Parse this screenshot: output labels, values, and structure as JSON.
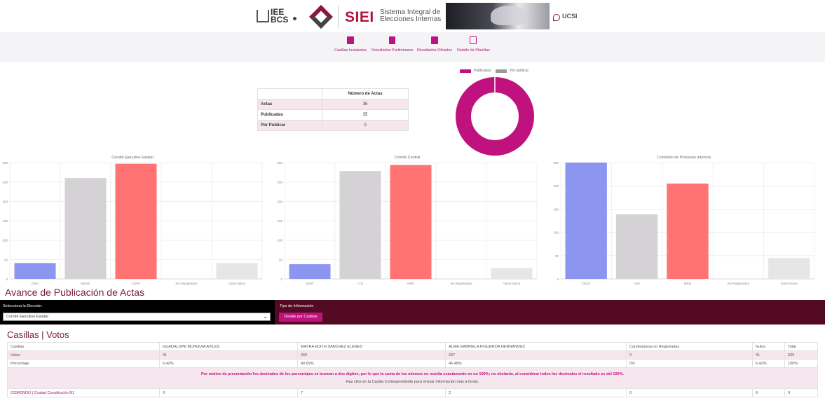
{
  "header": {
    "logo_text": "IEE BCS",
    "brand": "SIEI",
    "brand_subtitle": "Sistema Integral de Elecciones Internas",
    "org": "UCSI"
  },
  "nav": {
    "items": [
      {
        "label": "Casillas Instaladas",
        "icon": "boxes-icon"
      },
      {
        "label": "Resultados Preliminares",
        "icon": "document-icon"
      },
      {
        "label": "Resultados Oficiales",
        "icon": "ballot-icon"
      },
      {
        "label": "Detalle de Planillas",
        "icon": "table-icon"
      }
    ]
  },
  "summary": {
    "header": "Número de Actas",
    "rows": [
      {
        "label": "Actas",
        "value": "35"
      },
      {
        "label": "Publicadas",
        "value": "35"
      },
      {
        "label": "Por Publicar",
        "value": "0"
      }
    ]
  },
  "colors": {
    "accent": "#c0127e",
    "dark": "#540a22",
    "title": "#7a1740",
    "blue": "#8c96f0",
    "gray": "#d5d2d6",
    "red": "#ff7373",
    "light": "#e6e6e6"
  },
  "chart_data": [
    {
      "type": "pie",
      "variant": "doughnut",
      "legend": [
        "Publicadas",
        "Por publicar"
      ],
      "values": [
        35,
        0
      ],
      "colors": [
        "#c0127e",
        "#9b9b9b"
      ]
    },
    {
      "type": "bar",
      "title": "Comité Ejecutivo Estatal",
      "categories": [
        "GMA",
        "MESE",
        "AGFH",
        "No Registrados",
        "Votos Nulos"
      ],
      "values": [
        41,
        260,
        297,
        0,
        41
      ],
      "ylim": [
        0,
        300
      ],
      "yticks": [
        0,
        50,
        100,
        150,
        200,
        250,
        300
      ],
      "grid": true
    },
    {
      "type": "bar",
      "title": "Comité Central",
      "categories": [
        "MGR",
        "LTG",
        "AIRG",
        "No Registrados",
        "Votos Nulos"
      ],
      "values": [
        38,
        278,
        294,
        0,
        28
      ],
      "ylim": [
        0,
        300
      ],
      "yticks": [
        0,
        50,
        100,
        150,
        200,
        250,
        300
      ],
      "grid": true
    },
    {
      "type": "bar",
      "title": "Comisión de Procesos Internos",
      "categories": [
        "ZDZO",
        "JSR",
        "MGB",
        "No Registrados",
        "Votos Nulos"
      ],
      "values": [
        250,
        139,
        205,
        0,
        45
      ],
      "ylim": [
        0,
        250
      ],
      "yticks": [
        0,
        50,
        100,
        150,
        200,
        250
      ],
      "grid": true
    }
  ],
  "section": {
    "title": "Avance de Publicación de Actas",
    "select_label": "Selecciona la Elección:",
    "select_value": "Comité Ejecutivo Estatal",
    "tipo_label": "Tipo de Información",
    "button_label": "Detalle por Casillas"
  },
  "votes": {
    "title": "Casillas | Votos",
    "headers": [
      "Casillas",
      "GUADALUPE MUNGUIA AVILES",
      "MAYRA EDITH SANCHEZ ELENES",
      "ALMA GABRIELA FIGUEROA HERNANDEZ",
      "Candidaturas no Registradas",
      "Nulos",
      "Total"
    ],
    "votos": [
      "Votos",
      "41",
      "260",
      "297",
      "0",
      "41",
      "639"
    ],
    "porcentaje": [
      "Porcentaje",
      "6.42%",
      "40.69%",
      "46.48%",
      "0%",
      "6.42%",
      "100%"
    ],
    "note": "Por motivo de presentación los decimales de los porcentajes se truncan a dos dígitos, por lo que la suma de los mismos no resulta exactamente en un 100%; no obstante, al considerar todos los decimales el resultado es del 100%.",
    "note2": "Haz click en la Casilla Correspondiente para revisar información más a fondo.",
    "row": [
      "COMONDÚ | Ciudad Constitución B1",
      "0",
      "7",
      "2",
      "0",
      "0",
      "9"
    ]
  }
}
